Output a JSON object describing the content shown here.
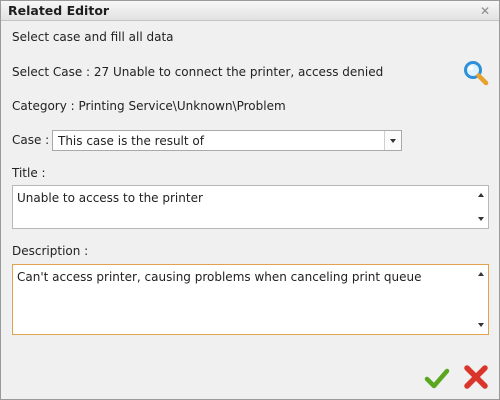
{
  "window": {
    "title": "Related Editor"
  },
  "header": {
    "instruction": "Select case and fill all data",
    "select_case": "Select Case : 27 Unable to connect the printer, access denied",
    "category": "Category : Printing Service\\Unknown\\Problem"
  },
  "form": {
    "case_label": "Case :",
    "case_value": "This case is the result of",
    "title_label": "Title :",
    "title_value": "Unable to access to the printer",
    "description_label": "Description :",
    "description_value": "Can't access printer, causing problems when canceling print queue"
  },
  "icons": {
    "search": "search-icon",
    "ok": "checkmark-icon",
    "cancel": "x-icon",
    "close": "close-icon"
  },
  "colors": {
    "accent_focus_border": "#e1a34f",
    "ok_green": "#5aa61f",
    "cancel_red": "#d9352b",
    "search_blue": "#2f8fd8"
  }
}
